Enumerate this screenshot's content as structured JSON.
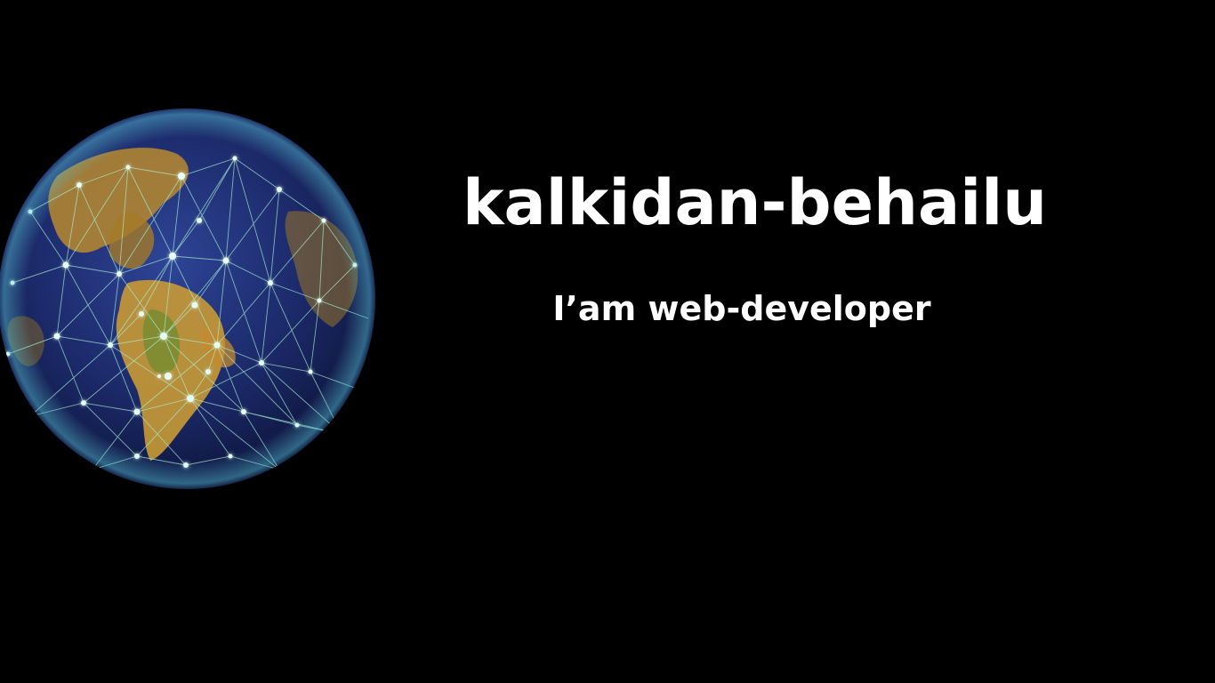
{
  "hero": {
    "name": "kalkidan-behailu",
    "tagline": "I’am web-developer",
    "globe_image": "network-globe-icon"
  },
  "colors": {
    "background": "#000000",
    "text": "#ffffff",
    "network_lines": "#9fe3c8",
    "ocean": "#1d2c6b",
    "land": "#c9a23a"
  }
}
